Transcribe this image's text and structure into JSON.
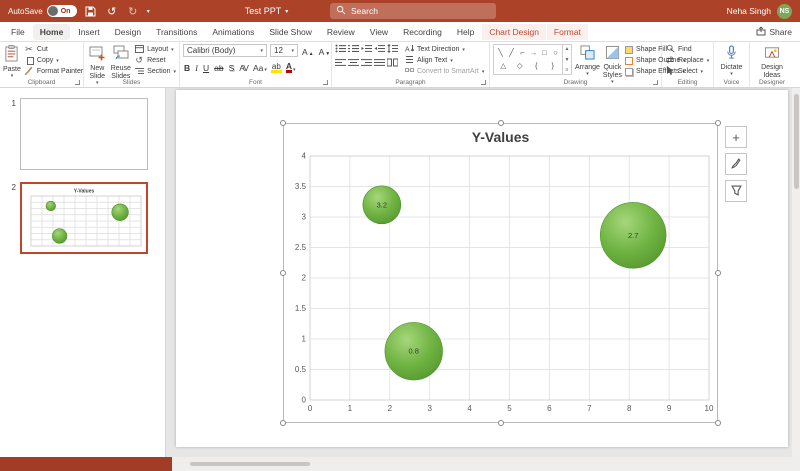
{
  "titlebar": {
    "autosave_label": "AutoSave",
    "autosave_state": "On",
    "doc_title": "Test PPT",
    "search_placeholder": "Search",
    "user_name": "Neha Singh",
    "user_initials": "NS"
  },
  "tabs": {
    "file": "File",
    "home": "Home",
    "insert": "Insert",
    "design": "Design",
    "transitions": "Transitions",
    "animations": "Animations",
    "slide_show": "Slide Show",
    "review": "Review",
    "view": "View",
    "recording": "Recording",
    "help": "Help",
    "chart_design": "Chart Design",
    "format": "Format",
    "share": "Share"
  },
  "icons": {
    "caret": "▾",
    "undo": "↺",
    "redo": "↻",
    "scissors": "✂",
    "replace": "⇄",
    "plus": "+"
  },
  "ribbon": {
    "clipboard": {
      "label": "Clipboard",
      "paste": "Paste",
      "cut": "Cut",
      "copy": "Copy",
      "format_painter": "Format Painter"
    },
    "slides": {
      "label": "Slides",
      "new_slide": "New Slide",
      "reuse_slides": "Reuse Slides",
      "layout": "Layout",
      "reset": "Reset",
      "section": "Section"
    },
    "font": {
      "label": "Font",
      "font_name": "Calibri (Body)",
      "font_size": "12",
      "bold": "B",
      "italic": "I",
      "underline": "U",
      "strike": "ab",
      "shadow": "S",
      "spacing": "AV",
      "case": "Aa",
      "grow": "A",
      "shrink": "A",
      "highlight": "ab",
      "color": "A"
    },
    "paragraph": {
      "label": "Paragraph",
      "text_direction": "Text Direction",
      "align_text": "Align Text",
      "smartart": "Convert to SmartArt"
    },
    "drawing": {
      "label": "Drawing",
      "arrange": "Arrange",
      "quick_styles": "Quick Styles",
      "shape_fill": "Shape Fill",
      "shape_outline": "Shape Outline",
      "shape_effects": "Shape Effects",
      "glyphs": [
        "╲",
        "╱",
        "⌐",
        "→",
        "□",
        "○",
        "△",
        "◇",
        "{",
        "}"
      ]
    },
    "editing": {
      "label": "Editing",
      "find": "Find",
      "replace": "Replace",
      "select": "Select"
    },
    "voice": {
      "label": "Voice",
      "dictate": "Dictate"
    },
    "designer": {
      "label": "Designer",
      "design_ideas": "Design Ideas"
    }
  },
  "slide_panel": {
    "slide1_number": "1",
    "slide2_number": "2"
  },
  "chart_data": {
    "type": "bubble",
    "title": "Y-Values",
    "xlabel": "",
    "ylabel": "",
    "xlim": [
      0,
      10
    ],
    "ylim": [
      0,
      4
    ],
    "x_ticks": [
      0,
      1,
      2,
      3,
      4,
      5,
      6,
      7,
      8,
      9,
      10
    ],
    "y_ticks": [
      0,
      0.5,
      1,
      1.5,
      2,
      2.5,
      3,
      3.5,
      4
    ],
    "grid": true,
    "legend": "none",
    "bubble_color": "#6FAE3E",
    "series": [
      {
        "name": "Y-Values",
        "points": [
          {
            "x": 1.8,
            "y": 3.2,
            "size": 1.0,
            "label": "3.2"
          },
          {
            "x": 8.1,
            "y": 2.7,
            "size": 3.0,
            "label": "2.7"
          },
          {
            "x": 2.6,
            "y": 0.8,
            "size": 2.3,
            "label": "0.8"
          }
        ]
      }
    ]
  }
}
